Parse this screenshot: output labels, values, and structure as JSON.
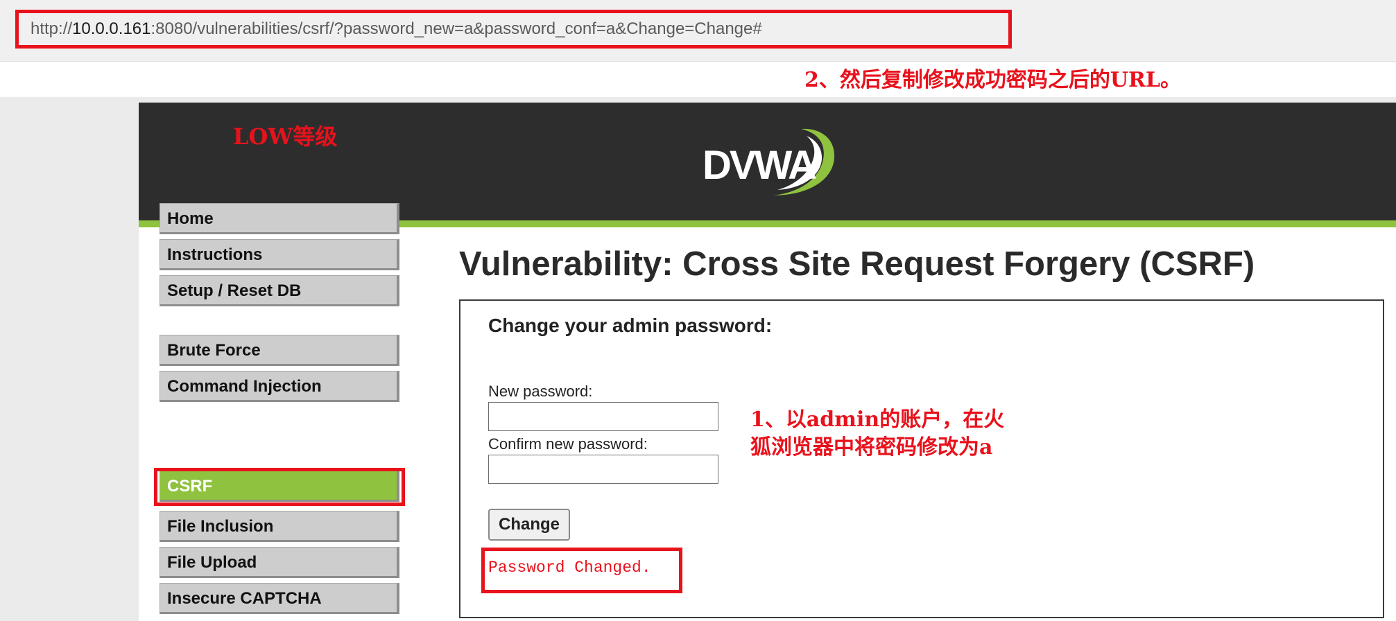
{
  "browser": {
    "url_prefix": "http://",
    "url_host": "10.0.0.161",
    "url_rest": ":8080/vulnerabilities/csrf/?password_new=a&password_conf=a&Change=Change#"
  },
  "annotations": {
    "step2": "2、然后复制修改成功密码之后的URL。",
    "level": "LOW等级",
    "step1_line1": "1、以admin的账户，在火",
    "step1_line2": "狐浏览器中将密码修改为a",
    "highlight_color": "#e8121c"
  },
  "header": {
    "logo_text": "DVWA",
    "accent_color": "#8fc23f"
  },
  "menu": {
    "items": [
      {
        "label": "Home"
      },
      {
        "label": "Instructions"
      },
      {
        "label": "Setup / Reset DB"
      },
      {
        "label": "Brute Force"
      },
      {
        "label": "Command Injection"
      },
      {
        "label": "CSRF",
        "selected": true
      },
      {
        "label": "File Inclusion"
      },
      {
        "label": "File Upload"
      },
      {
        "label": "Insecure CAPTCHA"
      }
    ]
  },
  "main": {
    "title": "Vulnerability: Cross Site Request Forgery (CSRF)",
    "form": {
      "heading": "Change your admin password:",
      "new_password_label": "New password:",
      "new_password_value": "",
      "confirm_password_label": "Confirm new password:",
      "confirm_password_value": "",
      "submit_label": "Change",
      "result_message": "Password Changed."
    }
  }
}
